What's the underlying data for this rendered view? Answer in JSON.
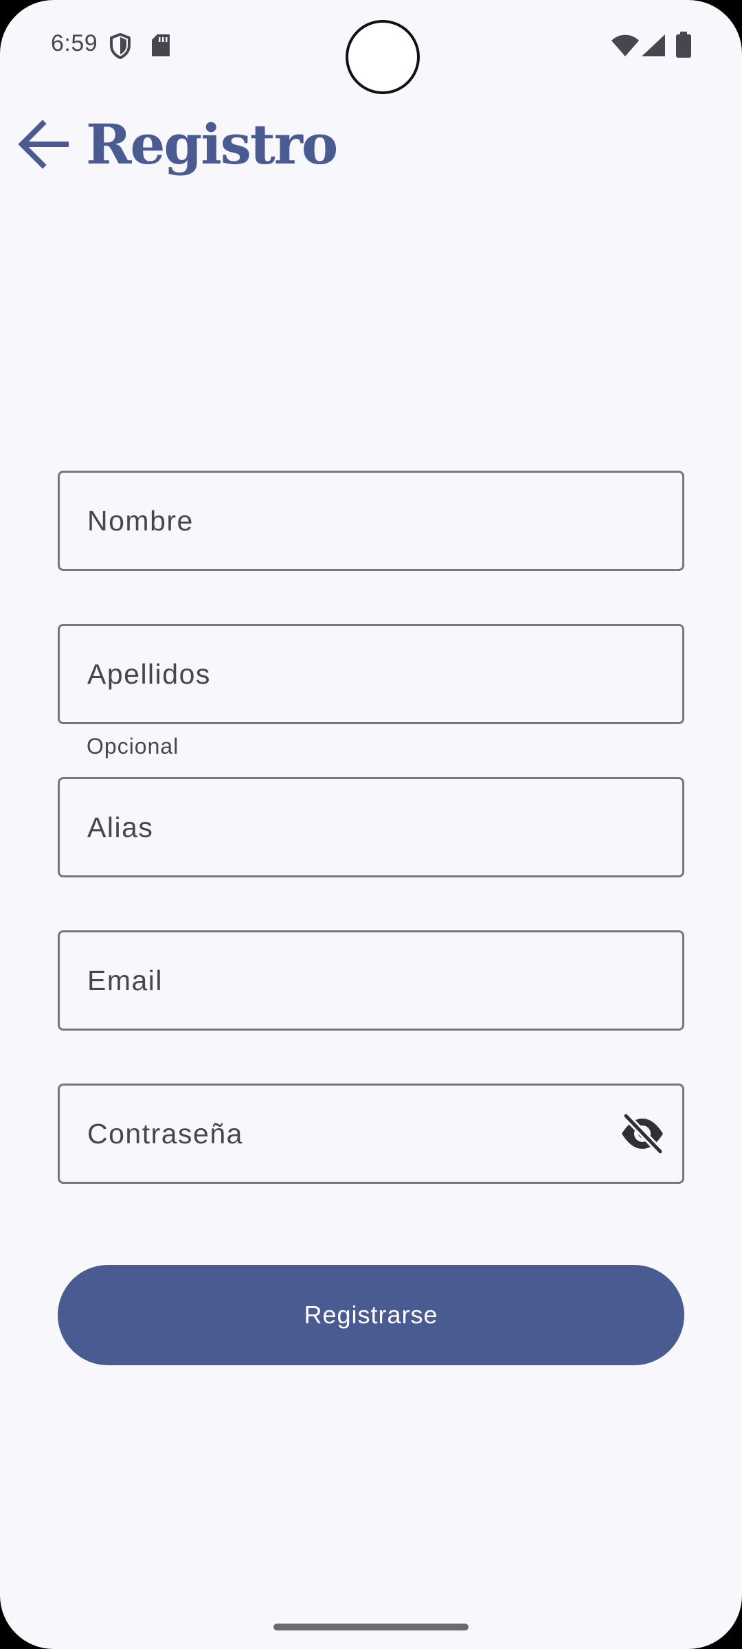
{
  "status_bar": {
    "time": "6:59",
    "icons": [
      "shield-icon",
      "sd-card-icon",
      "wifi-icon",
      "signal-icon",
      "battery-icon"
    ]
  },
  "app_bar": {
    "back_icon": "arrow-back-icon",
    "title": "Registro"
  },
  "form": {
    "fields": [
      {
        "label": "Nombre",
        "value": ""
      },
      {
        "label": "Apellidos",
        "value": "",
        "supporting_text": "Opcional"
      },
      {
        "label": "Alias",
        "value": ""
      },
      {
        "label": "Email",
        "value": ""
      },
      {
        "label": "Contraseña",
        "value": "",
        "trailing_icon": "visibility-off-icon"
      }
    ],
    "submit_label": "Registrarse"
  },
  "colors": {
    "primary": "#4a5b91",
    "background": "#f8f7fc",
    "outline": "#767680",
    "on_surface_variant": "#45464f"
  }
}
